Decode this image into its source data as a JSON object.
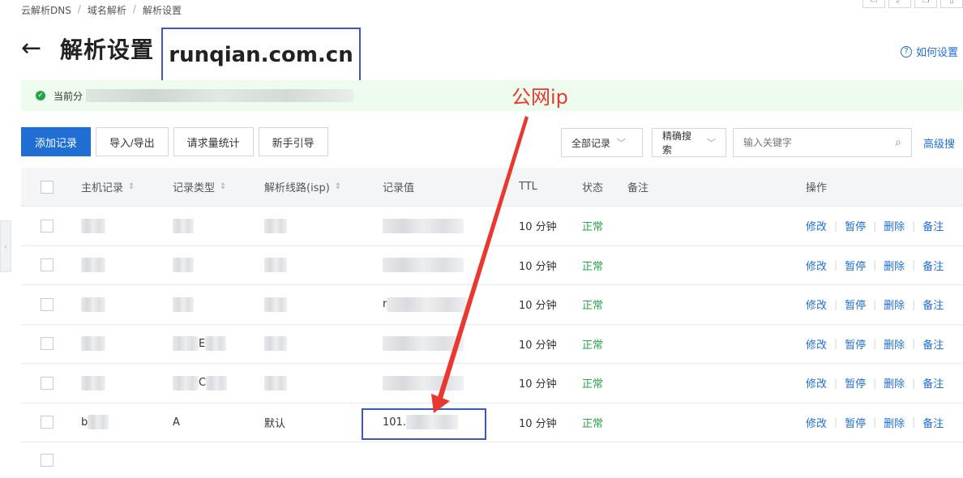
{
  "breadcrumb": [
    "云解析DNS",
    "域名解析",
    "解析设置"
  ],
  "header": {
    "title": "解析设置",
    "domain": "runqian.com.cn",
    "help_link": "如何设置"
  },
  "status_banner": {
    "text_prefix": "当前分"
  },
  "annotation": {
    "label": "公网ip",
    "color": "#e8382f"
  },
  "toolbar": {
    "add": "添加记录",
    "import_export": "导入/导出",
    "stats": "请求量统计",
    "guide": "新手引导"
  },
  "filters": {
    "record_scope": "全部记录",
    "search_mode": "精确搜索",
    "search_placeholder": "输入关键字",
    "advanced": "高级搜"
  },
  "table": {
    "headers": {
      "host": "主机记录",
      "type": "记录类型",
      "line": "解析线路(isp)",
      "value": "记录值",
      "ttl": "TTL",
      "status": "状态",
      "remark": "备注",
      "actions": "操作"
    },
    "action_labels": {
      "edit": "修改",
      "pause": "暂停",
      "delete": "删除",
      "remark": "备注"
    },
    "rows": [
      {
        "host": "",
        "type": "",
        "line": "",
        "value": "",
        "ttl": "10 分钟",
        "status": "正常"
      },
      {
        "host": "",
        "type": "",
        "line": "",
        "value": "",
        "ttl": "10 分钟",
        "status": "正常"
      },
      {
        "host": "",
        "type": "",
        "line": "",
        "value": "r",
        "ttl": "10 分钟",
        "status": "正常"
      },
      {
        "host": "",
        "type": "E",
        "line": "",
        "value": "",
        "ttl": "10 分钟",
        "status": "正常"
      },
      {
        "host": "",
        "type": "C",
        "line": "",
        "value": "",
        "ttl": "10 分钟",
        "status": "正常"
      },
      {
        "host": "b",
        "type": "A",
        "line": "默认",
        "value": "101.",
        "ttl": "10 分钟",
        "status": "正常"
      }
    ]
  },
  "colors": {
    "primary": "#1f6ed4",
    "success": "#29a34a",
    "annotation_red": "#e8382f",
    "highlight_box": "#3c58b8",
    "banner_bg": "#eefbef"
  }
}
